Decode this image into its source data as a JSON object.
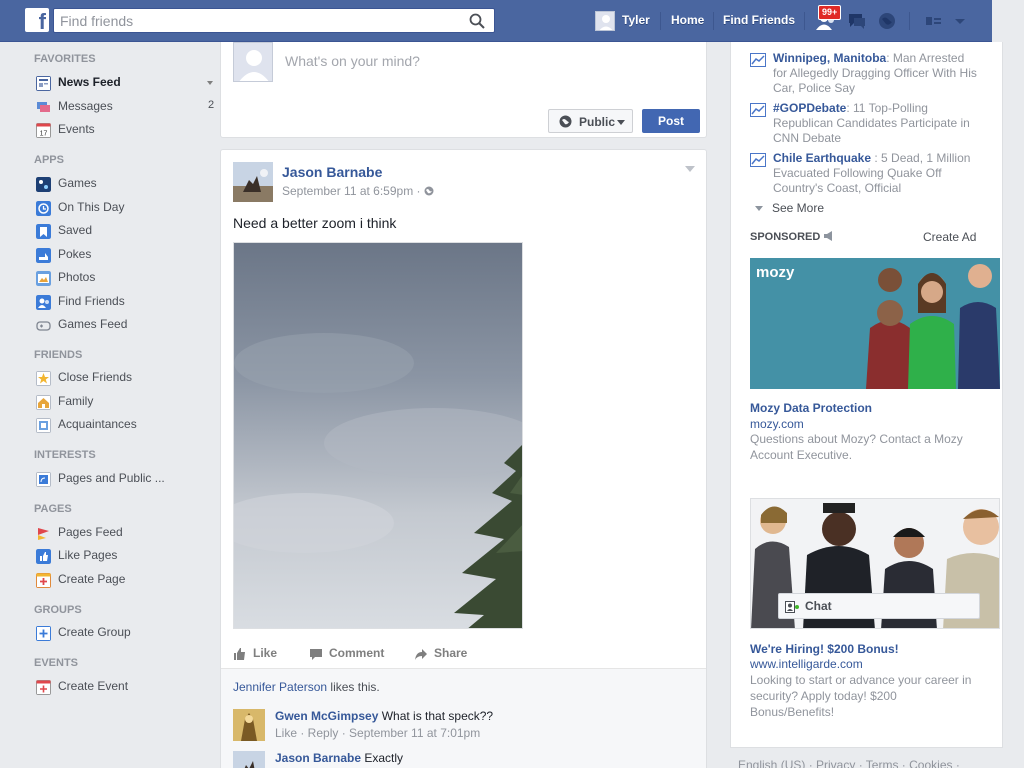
{
  "topbar": {
    "search_placeholder": "Find friends",
    "user_name": "Tyler",
    "home": "Home",
    "find_friends": "Find Friends",
    "notif_badge": "99+"
  },
  "sidebar": {
    "sections": {
      "favorites": "FAVORITES",
      "apps": "APPS",
      "friends": "FRIENDS",
      "interests": "INTERESTS",
      "pages": "PAGES",
      "groups": "GROUPS",
      "events": "EVENTS"
    },
    "items": {
      "news_feed": "News Feed",
      "messages": "Messages",
      "messages_count": "2",
      "events": "Events",
      "games": "Games",
      "on_this_day": "On This Day",
      "saved": "Saved",
      "pokes": "Pokes",
      "photos": "Photos",
      "find_friends": "Find Friends",
      "games_feed": "Games Feed",
      "close_friends": "Close Friends",
      "family": "Family",
      "acquaintances": "Acquaintances",
      "pages_public": "Pages and Public ...",
      "pages_feed": "Pages Feed",
      "like_pages": "Like Pages",
      "create_page": "Create Page",
      "create_group": "Create Group",
      "create_event": "Create Event"
    },
    "calendar_day": "17"
  },
  "composer": {
    "placeholder": "What's on your mind?",
    "privacy": "Public",
    "post": "Post"
  },
  "post": {
    "author": "Jason Barnabe",
    "meta": "September 11 at 6:59pm ·",
    "text": "Need a better zoom i think",
    "actions": {
      "like": "Like",
      "comment": "Comment",
      "share": "Share"
    },
    "likes_name": "Jennifer Paterson",
    "likes_suffix": " likes this.",
    "comments": [
      {
        "name": "Gwen McGimpsey",
        "text": " What is that speck??",
        "meta": "Like · Reply · September 11 at 7:01pm"
      },
      {
        "name": "Jason Barnabe",
        "text": " Exactly",
        "meta": ""
      }
    ]
  },
  "trending": [
    {
      "title": "Winnipeg, Manitoba",
      "text": ": Man Arrested for Allegedly Dragging Officer With His Car, Police Say"
    },
    {
      "title": "#GOPDebate",
      "text": ": 11 Top-Polling Republican Candidates Participate in CNN Debate"
    },
    {
      "title": "Chile Earthquake",
      "text": " : 5 Dead, 1 Million Evacuated Following Quake Off Country's Coast, Official"
    }
  ],
  "right": {
    "see_more": "See More",
    "sponsored": "SPONSORED",
    "create_ad": "Create Ad",
    "chat": "Chat",
    "footer": "English (US) · Privacy · Terms · Cookies ·"
  },
  "ads": [
    {
      "brand_logo": "mozy",
      "title": "Mozy Data Protection",
      "url": "mozy.com",
      "desc": "Questions about Mozy? Contact a Mozy Account Executive."
    },
    {
      "title": "We're Hiring! $200 Bonus!",
      "url": "www.intelligarde.com",
      "desc": "Looking to start or advance your career in security? Apply today! $200 Bonus/Benefits!"
    }
  ],
  "colors": {
    "brand": "#4a66a0",
    "link": "#365899",
    "post_button": "#4267b2",
    "badge": "#e02a26"
  }
}
